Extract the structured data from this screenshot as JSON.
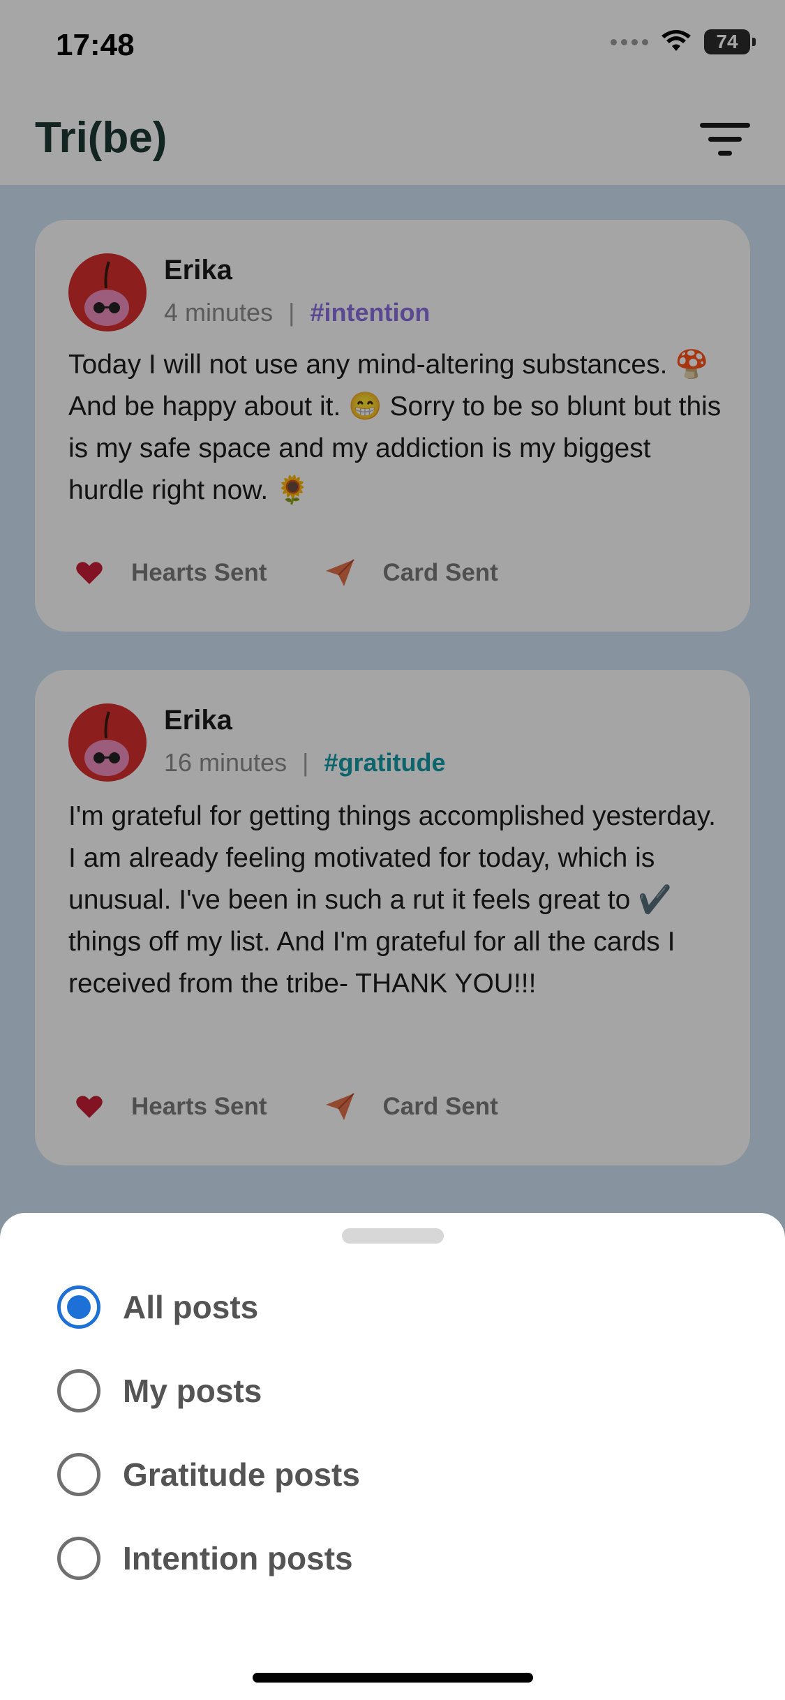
{
  "status_bar": {
    "time": "17:48",
    "battery": "74"
  },
  "header": {
    "title": "Tri(be)"
  },
  "posts": [
    {
      "author": "Erika",
      "time": "4 minutes",
      "separator": "|",
      "tag": "#intention",
      "text": "Today I will not use any mind-altering substances. 🍄 And be happy about it. 😁 Sorry to be so blunt but this is my safe space and my addiction is my biggest hurdle right now. 🌻",
      "hearts_label": "Hearts Sent",
      "card_label": "Card Sent"
    },
    {
      "author": "Erika",
      "time": "16 minutes",
      "separator": "|",
      "tag": "#gratitude",
      "text": "I'm grateful for getting things accomplished yesterday. I am already feeling motivated for today, which is unusual. I've been in such a rut it feels great to ✔️ things off my list. And I'm grateful for all the cards I received from the tribe- THANK YOU!!!",
      "hearts_label": "Hearts Sent",
      "card_label": "Card Sent"
    }
  ],
  "filter_sheet": {
    "options": [
      {
        "label": "All posts",
        "selected": true
      },
      {
        "label": "My posts",
        "selected": false
      },
      {
        "label": "Gratitude posts",
        "selected": false
      },
      {
        "label": "Intention posts",
        "selected": false
      }
    ]
  },
  "colors": {
    "accent": "#1d71d6",
    "heart": "#c81e37",
    "send": "#e0704a",
    "intention_tag": "#8a70e0",
    "gratitude_tag": "#139aa6"
  }
}
